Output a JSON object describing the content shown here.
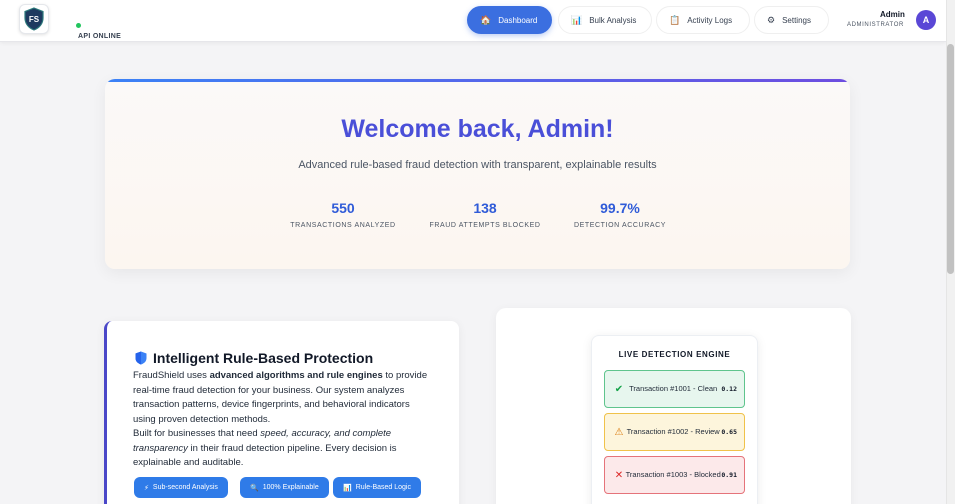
{
  "header": {
    "logo_text": "FS",
    "api_status": "API ONLINE",
    "nav": [
      {
        "label": "Dashboard",
        "icon": "house-icon",
        "glyph": "🏠",
        "active": true
      },
      {
        "label": "Bulk Analysis",
        "icon": "bar-chart-icon",
        "glyph": "📊",
        "active": false
      },
      {
        "label": "Activity Logs",
        "icon": "clipboard-icon",
        "glyph": "📋",
        "active": false
      },
      {
        "label": "Settings",
        "icon": "gear-icon",
        "glyph": "⚙",
        "active": false
      }
    ],
    "user": {
      "name": "Admin",
      "role": "ADMINISTRATOR",
      "initial": "A"
    }
  },
  "welcome": {
    "title": "Welcome back, Admin!",
    "subtitle": "Advanced rule-based fraud detection with transparent, explainable results",
    "stats": [
      {
        "value": "550",
        "label": "TRANSACTIONS ANALYZED"
      },
      {
        "value": "138",
        "label": "FRAUD ATTEMPTS BLOCKED"
      },
      {
        "value": "99.7%",
        "label": "DETECTION ACCURACY"
      }
    ]
  },
  "protection": {
    "title": "Intelligent Rule-Based Protection",
    "paragraph1": {
      "before": "FraudShield uses ",
      "strong": "advanced algorithms and rule engines",
      "after": " to provide real-time fraud detection for your business. Our system analyzes transaction patterns, device fingerprints, and behavioral indicators using proven detection methods."
    },
    "paragraph2": {
      "before": "Built for businesses that need ",
      "em": "speed, accuracy, and complete transparency",
      "after": " in their fraud detection pipeline. Every decision is explainable and auditable."
    },
    "chips": [
      {
        "label": "Sub-second Analysis",
        "glyph": "⚡"
      },
      {
        "label": "100% Explainable",
        "glyph": "🔍"
      },
      {
        "label": "Rule-Based Logic",
        "glyph": "📊"
      }
    ]
  },
  "engine": {
    "title": "LIVE DETECTION ENGINE",
    "transactions": [
      {
        "label": "Transaction #1001 - Clean",
        "score": "0.12",
        "status": "clean",
        "glyph": "✔"
      },
      {
        "label": "Transaction #1002 - Review",
        "score": "0.65",
        "status": "review",
        "glyph": "⚠"
      },
      {
        "label": "Transaction #1003 - Blocked",
        "score": "0.91",
        "status": "blocked",
        "glyph": "✕"
      }
    ]
  },
  "colors": {
    "accent": "#3b6fe0",
    "title": "#4a4fd8",
    "stat": "#2f5bd8",
    "online": "#22c55e"
  }
}
